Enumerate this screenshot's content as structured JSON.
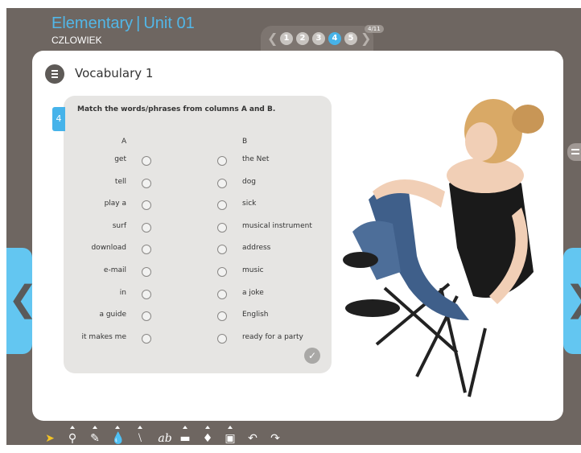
{
  "header": {
    "title_main": "Elementary",
    "title_separator": "|",
    "title_unit": "Unit 01",
    "subtitle": "CZLOWIEK"
  },
  "pager": {
    "pages": [
      "1",
      "2",
      "3",
      "4",
      "5"
    ],
    "active_page": "4",
    "count": "4/11",
    "active_color": "#47b3e8"
  },
  "section": {
    "title": "Vocabulary 1",
    "icon": "document-list-icon"
  },
  "exercise": {
    "number": "4",
    "instruction": "Match the words/phrases from columns A and B.",
    "column_a_header": "A",
    "column_b_header": "B",
    "column_a": [
      "get",
      "tell",
      "play a",
      "surf",
      "download",
      "e-mail",
      "in",
      "a guide",
      "it makes me"
    ],
    "column_b": [
      "the Net",
      "dog",
      "sick",
      "musical instrument",
      "address",
      "music",
      "a joke",
      "English",
      "ready for a party"
    ],
    "check_icon": "check-icon"
  },
  "navigation": {
    "prev_icon": "chevron-left-icon",
    "next_icon": "chevron-right-icon",
    "side_tab_icon": "notes-icon",
    "color": "#63c6f1"
  },
  "toolbar": {
    "tools": [
      "pointer-icon",
      "zoom-icon",
      "pen-icon",
      "fill-icon",
      "line-icon",
      "text-icon",
      "rectangle-icon",
      "eraser-icon",
      "save-icon",
      "undo-icon",
      "redo-icon"
    ],
    "text_tool_label": "ab"
  },
  "colors": {
    "accent": "#47b3e8",
    "background": "#6e6661",
    "panel": "#ffffff",
    "exercise_bg": "#e6e5e3"
  }
}
